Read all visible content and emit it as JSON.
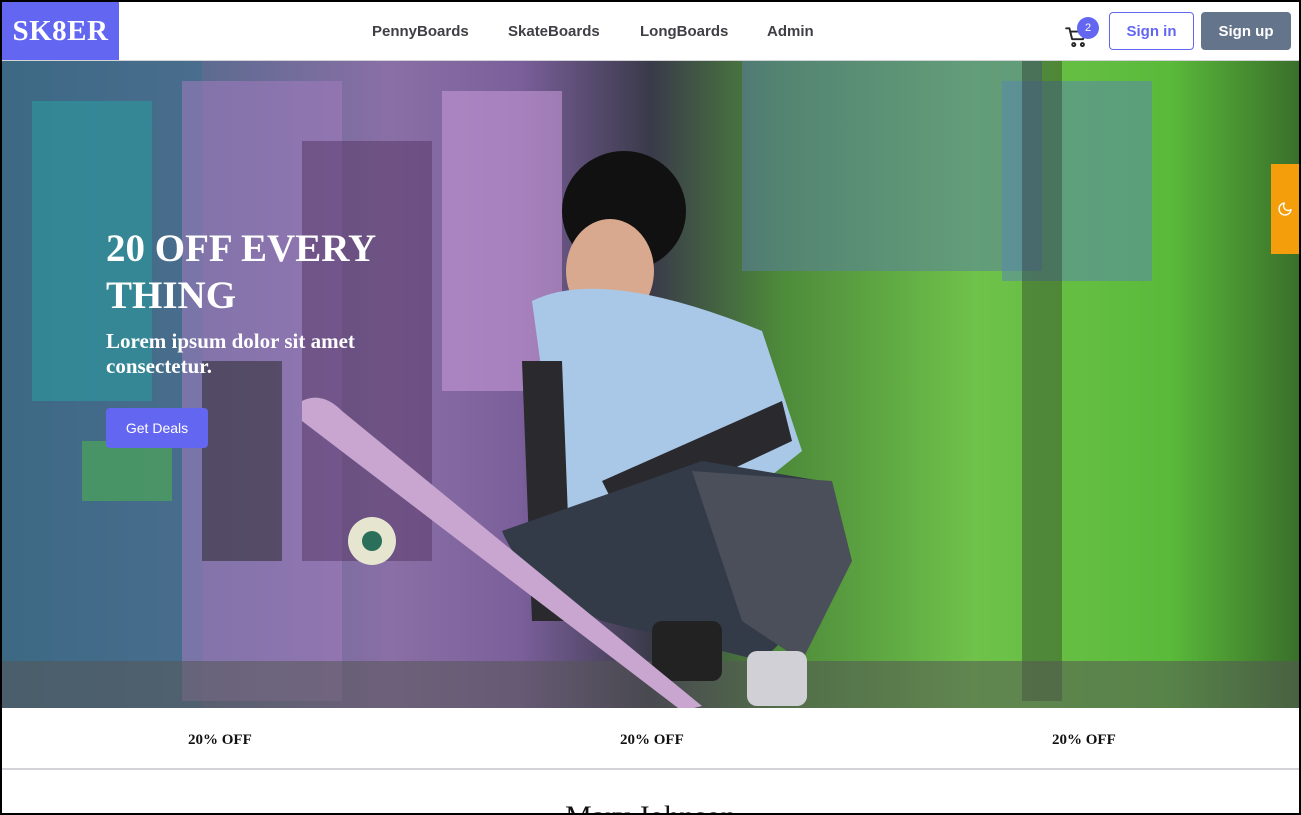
{
  "brand": {
    "logo": "SK8ER",
    "accent": "#6366f1"
  },
  "nav": {
    "links": [
      {
        "label": "PennyBoards"
      },
      {
        "label": "SkateBoards"
      },
      {
        "label": "LongBoards"
      },
      {
        "label": "Admin"
      }
    ],
    "cart_icon": "cart-icon",
    "cart_count": "2",
    "signin_label": "Sign in",
    "signup_label": "Sign up"
  },
  "hero": {
    "title": "20 OFF EVERY THING",
    "subtitle": "Lorem ipsum dolor sit amet consectetur.",
    "cta_label": "Get Deals",
    "image": "skater-with-graffiti-wall"
  },
  "theme_toggle": {
    "icon": "moon-icon",
    "color": "#f59e0b"
  },
  "promos": [
    {
      "label": "20% OFF"
    },
    {
      "label": "20% OFF"
    },
    {
      "label": "20% OFF"
    }
  ],
  "next_section": {
    "title": "Mary Johnson"
  }
}
